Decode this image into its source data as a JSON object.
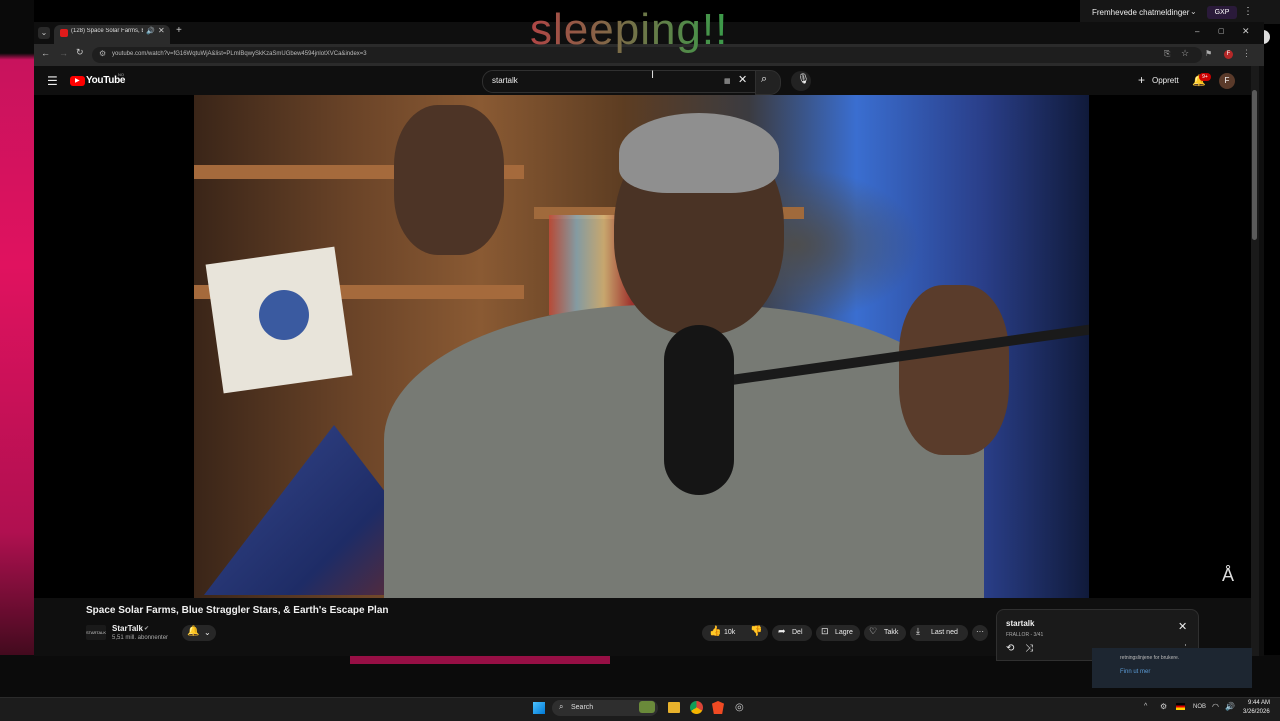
{
  "overlay": {
    "sleeping_text": "sleeping!!"
  },
  "chat_bar": {
    "label": "Fremhevede chatmeldinger",
    "badge": "GXP",
    "menu": "⋮"
  },
  "browser": {
    "tab_title": "(128) Space Solar Farms, Bl",
    "url": "youtube.com/watch?v=fG16WqtuWjA&list=PLmIBqwySkKzaSmUGbew4594jnlotXVCa&index=3",
    "new_tab": "+",
    "window_controls": {
      "minimize": "–",
      "maximize": "▢",
      "close": "✕"
    }
  },
  "youtube": {
    "logo_text": "YouTube",
    "country_code": "NO",
    "search_value": "startalk",
    "create_label": "Opprett",
    "notification_count": "9+",
    "account_initial": "F"
  },
  "video": {
    "title": "Space Solar Farms, Blue Straggler Stars, & Earth's Escape Plan",
    "channel_name": "StarTalk",
    "channel_avatar_text": "STARTALK",
    "subscribers": "5,51 mill. abonnenter",
    "likes": "10k",
    "share_label": "Del",
    "save_label": "Lagre",
    "thanks_label": "Takk",
    "download_label": "Last ned",
    "more": "···"
  },
  "playlist": {
    "title": "startalk",
    "meta": "FRALLOR - 3/41"
  },
  "notification": {
    "text": "retningslinjene for brukere.",
    "link": "Finn ut mer"
  },
  "taskbar": {
    "search_label": "Search",
    "language": "NOB",
    "time": "9:44 AM",
    "date": "3/26/2026"
  },
  "colors": {
    "youtube_red": "#ff0000",
    "page_bg": "#0f0f0f",
    "desktop_pink": "#e0125f"
  }
}
